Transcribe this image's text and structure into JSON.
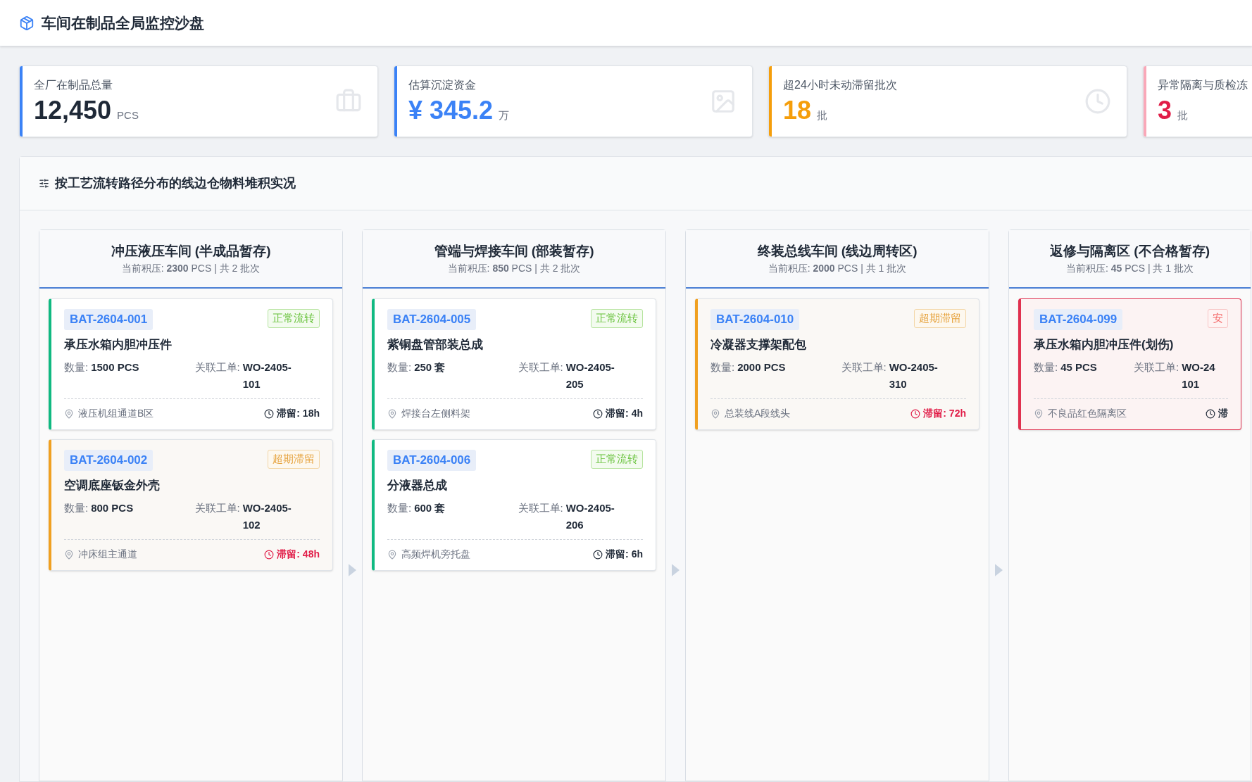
{
  "header": {
    "title": "车间在制品全局监控沙盘"
  },
  "kpis": [
    {
      "label": "全厂在制品总量",
      "value": "12,450",
      "unit": "PCS",
      "kind": "neutral"
    },
    {
      "label": "估算沉淀资金",
      "value": "¥ 345.2",
      "unit": "万",
      "kind": "money"
    },
    {
      "label": "超24小时未动滞留批次",
      "value": "18",
      "unit": "批",
      "kind": "warning"
    },
    {
      "label": "异常隔离与质检冻",
      "value": "3",
      "unit": "批",
      "kind": "danger"
    }
  ],
  "board": {
    "title": "按工艺流转路径分布的线边仓物料堆积实况",
    "columns": [
      {
        "title": "冲压液压车间 (半成品暂存)",
        "summary": "当前积压: **2300** PCS | 共 2 批次",
        "cards": [
          {
            "batch": "BAT-2604-001",
            "status": "正常流转",
            "kind": "normal",
            "name": "承压水箱内胆冲压件",
            "qty_label": "数量:",
            "qty": "1500 PCS",
            "order_label": "关联工单:",
            "order_lines": [
              "WO-2405-",
              "101"
            ],
            "location": "液压机组通道B区",
            "stay": "滞留: 18h"
          },
          {
            "batch": "BAT-2604-002",
            "status": "超期滞留",
            "kind": "overdue",
            "name": "空调底座钣金外壳",
            "qty_label": "数量:",
            "qty": "800 PCS",
            "order_label": "关联工单:",
            "order_lines": [
              "WO-2405-",
              "102"
            ],
            "location": "冲床组主通道",
            "stay": "滞留: 48h"
          }
        ]
      },
      {
        "title": "管端与焊接车间 (部装暂存)",
        "summary": "当前积压: **850** PCS | 共 2 批次",
        "cards": [
          {
            "batch": "BAT-2604-005",
            "status": "正常流转",
            "kind": "normal",
            "name": "紫铜盘管部装总成",
            "qty_label": "数量:",
            "qty": "250 套",
            "order_label": "关联工单:",
            "order_lines": [
              "WO-2405-",
              "205"
            ],
            "location": "焊接台左侧料架",
            "stay": "滞留: 4h"
          },
          {
            "batch": "BAT-2604-006",
            "status": "正常流转",
            "kind": "normal",
            "name": "分液器总成",
            "qty_label": "数量:",
            "qty": "600 套",
            "order_label": "关联工单:",
            "order_lines": [
              "WO-2405-",
              "206"
            ],
            "location": "高频焊机旁托盘",
            "stay": "滞留: 6h"
          }
        ]
      },
      {
        "title": "终装总线车间 (线边周转区)",
        "summary": "当前积压: **2000** PCS | 共 1 批次",
        "cards": [
          {
            "batch": "BAT-2604-010",
            "status": "超期滞留",
            "kind": "overdue",
            "name": "冷凝器支撑架配包",
            "qty_label": "数量:",
            "qty": "2000 PCS",
            "order_label": "关联工单:",
            "order_lines": [
              "WO-2405-",
              "310"
            ],
            "location": "总装线A段线头",
            "stay": "滞留: 72h"
          }
        ]
      },
      {
        "title": "返修与隔离区 (不合格暂存)",
        "summary": "当前积压: **45** PCS | 共 1 批次",
        "cards": [
          {
            "batch": "BAT-2604-099",
            "status": "安",
            "kind": "quarantine",
            "name": "承压水箱内胆冲压件(划伤)",
            "qty_label": "数量:",
            "qty": "45 PCS",
            "order_label": "关联工单:",
            "order_lines": [
              "WO-24",
              "101"
            ],
            "location": "不良品红色隔离区",
            "stay": "滞"
          }
        ]
      }
    ]
  }
}
